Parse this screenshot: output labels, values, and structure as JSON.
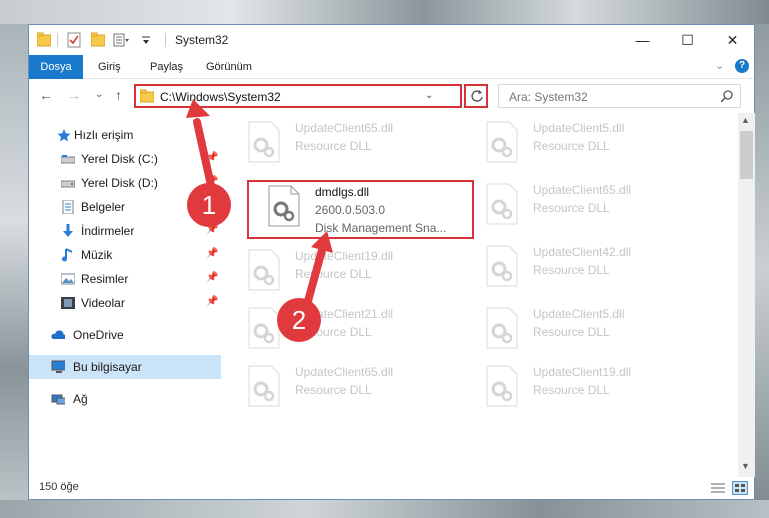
{
  "window": {
    "title": "System32",
    "controls": {
      "minimize": "—",
      "maximize": "☐",
      "close": "✕"
    }
  },
  "ribbon": {
    "tabs": [
      "Dosya",
      "Giriş",
      "Paylaş",
      "Görünüm"
    ],
    "help": "?"
  },
  "navigation": {
    "address": "C:\\Windows\\System32",
    "search_placeholder": "Ara: System32"
  },
  "sidebar": {
    "items": [
      {
        "label": "Hızlı erişim",
        "icon": "star-icon",
        "pinned": false
      },
      {
        "label": "Yerel Disk (C:)",
        "icon": "drive-icon",
        "pinned": true
      },
      {
        "label": "Yerel Disk (D:)",
        "icon": "drive-icon",
        "pinned": true
      },
      {
        "label": "Belgeler",
        "icon": "documents-icon",
        "pinned": true
      },
      {
        "label": "İndirmeler",
        "icon": "download-icon",
        "pinned": true
      },
      {
        "label": "Müzik",
        "icon": "music-icon",
        "pinned": true
      },
      {
        "label": "Resimler",
        "icon": "pictures-icon",
        "pinned": true
      },
      {
        "label": "Videolar",
        "icon": "video-icon",
        "pinned": true
      },
      {
        "label": "OneDrive",
        "icon": "cloud-icon",
        "pinned": false
      },
      {
        "label": "Bu bilgisayar",
        "icon": "computer-icon",
        "pinned": false
      },
      {
        "label": "Ağ",
        "icon": "network-icon",
        "pinned": false
      }
    ]
  },
  "files": {
    "left_column": [
      {
        "name": "UpdateClient65.dll",
        "desc": "Resource DLL"
      },
      {
        "name": "dmdlgs.dll",
        "version": "2600.0.503.0",
        "desc": "Disk Management Sna..."
      },
      {
        "name": "UpdateClient19.dll",
        "desc": "Resource DLL"
      },
      {
        "name": "UpdateClient21.dll",
        "desc": "Resource DLL"
      },
      {
        "name": "UpdateClient65.dll",
        "desc": "Resource DLL"
      }
    ],
    "right_column": [
      {
        "name": "UpdateClient5.dll",
        "desc": "Resource DLL"
      },
      {
        "name": "UpdateClient65.dll",
        "desc": "Resource DLL"
      },
      {
        "name": "UpdateClient42.dll",
        "desc": "Resource DLL"
      },
      {
        "name": "UpdateClient5.dll",
        "desc": "Resource DLL"
      },
      {
        "name": "UpdateClient19.dll",
        "desc": "Resource DLL"
      }
    ]
  },
  "status": {
    "item_count": "150 öğe"
  },
  "annotations": {
    "step1": "1",
    "step2": "2",
    "color": "#e0393e"
  }
}
